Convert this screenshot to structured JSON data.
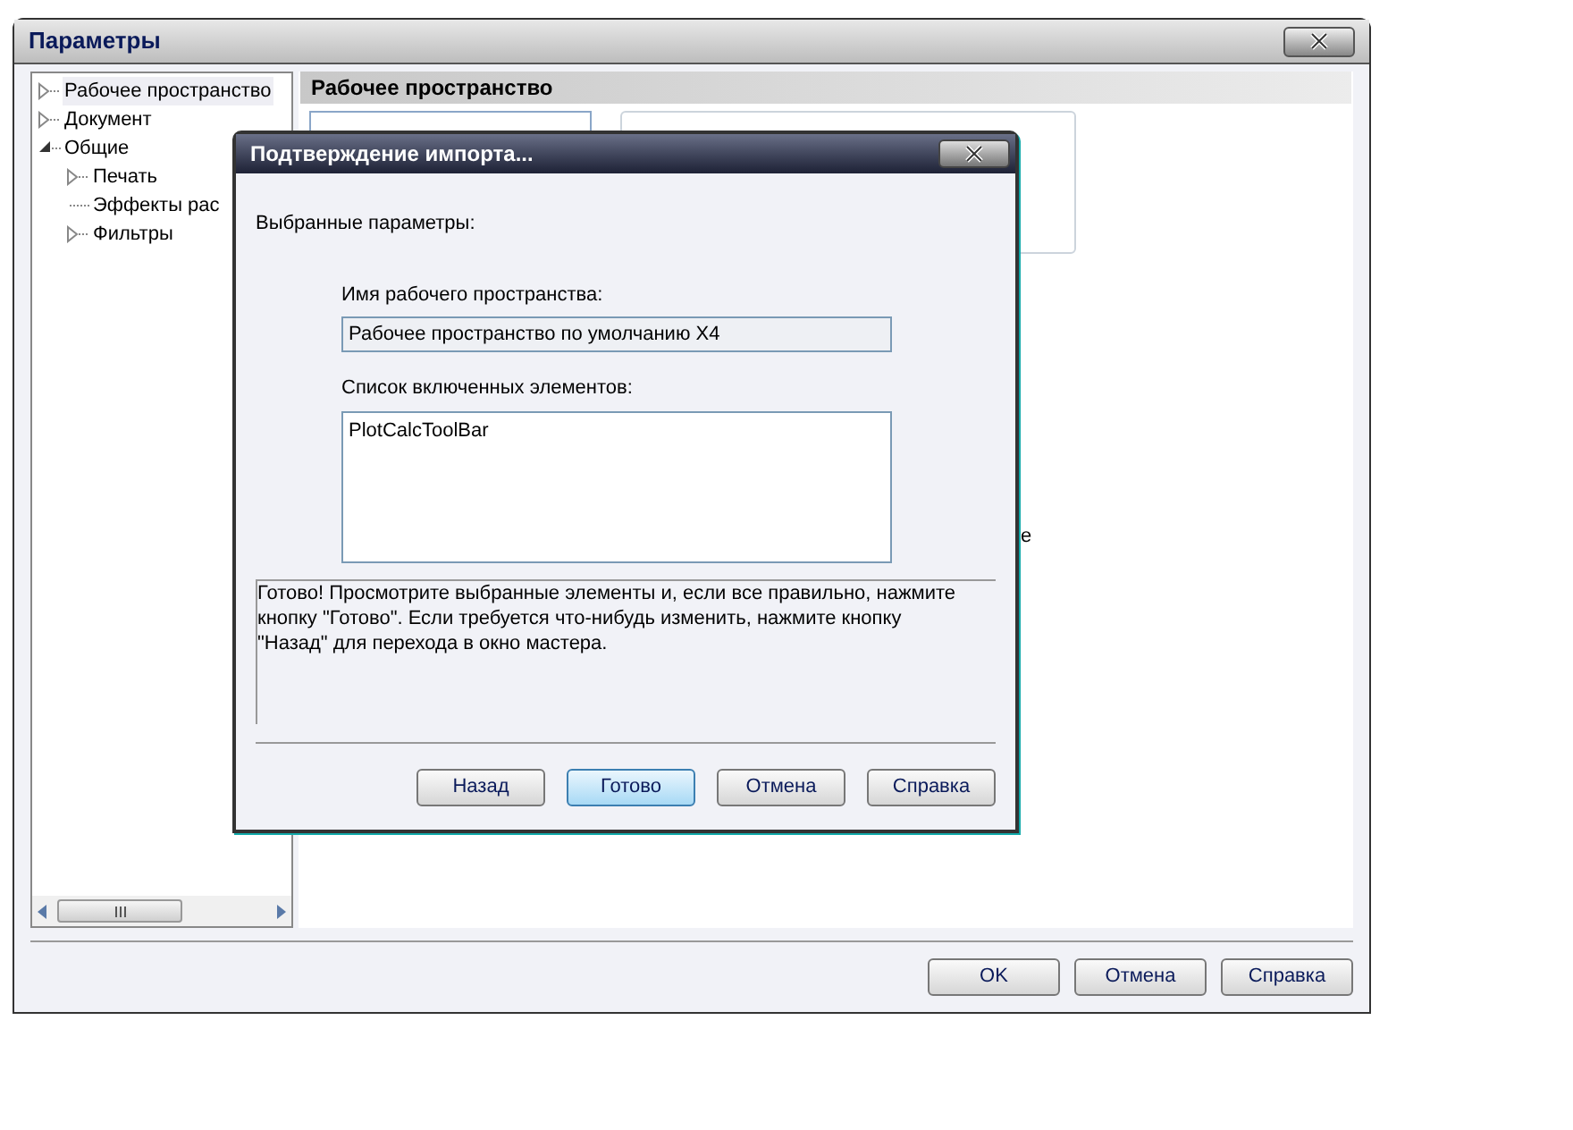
{
  "window": {
    "title": "Параметры"
  },
  "tree": [
    {
      "label": "Рабочее пространство",
      "selected": true,
      "expanded": false
    },
    {
      "label": "Документ",
      "selected": false,
      "expanded": false
    },
    {
      "label": "Общие",
      "selected": false,
      "expanded": true,
      "children": [
        {
          "label": "Печать",
          "selected": false,
          "expanded": false
        },
        {
          "label": "Эффекты рас",
          "selected": false,
          "kind": "leaf"
        },
        {
          "label": "Фильтры",
          "selected": false,
          "expanded": false
        }
      ]
    }
  ],
  "panel": {
    "title": "Рабочее пространство",
    "fragment": "е"
  },
  "buttons": [
    {
      "label": "OK"
    },
    {
      "label": "Отмена"
    },
    {
      "label": "Справка"
    }
  ],
  "dialog": {
    "title": "Подтверждение импорта...",
    "heading": "Выбранные параметры:",
    "name_label": "Имя рабочего пространства:",
    "name_value": "Рабочее пространство по умолчанию  X4",
    "list_label": "Список включенных элементов:",
    "list_items": [
      "PlotCalcToolBar"
    ],
    "message": "Готово! Просмотрите выбранные элементы и, если все правильно, нажмите кнопку \"Готово\". Если требуется что-нибудь изменить, нажмите кнопку \"Назад\" для перехода в окно мастера.",
    "buttons": [
      {
        "label": "Назад",
        "selected": false
      },
      {
        "label": "Готово",
        "selected": true
      },
      {
        "label": "Отмена",
        "selected": false
      },
      {
        "label": "Справка",
        "selected": false
      }
    ]
  }
}
